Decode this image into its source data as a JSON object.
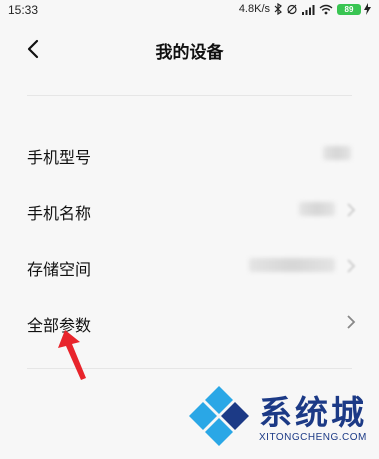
{
  "status_bar": {
    "time": "15:33",
    "network_speed": "4.8K/s",
    "battery": "89"
  },
  "header": {
    "title": "我的设备",
    "back_icon": "chevron-left-icon"
  },
  "settings": {
    "items": [
      {
        "label": "手机型号",
        "value_blurred": true,
        "has_chevron": false
      },
      {
        "label": "手机名称",
        "value_blurred": true,
        "has_chevron": true
      },
      {
        "label": "存储空间",
        "value_blurred": true,
        "has_chevron": true
      },
      {
        "label": "全部参数",
        "value_blurred": false,
        "has_chevron": true
      }
    ]
  },
  "annotation": {
    "arrow_color": "#e8242b"
  },
  "watermark": {
    "brand": "系统城",
    "url": "XITONGCHENG.COM",
    "brand_color": "#1c3a86"
  }
}
